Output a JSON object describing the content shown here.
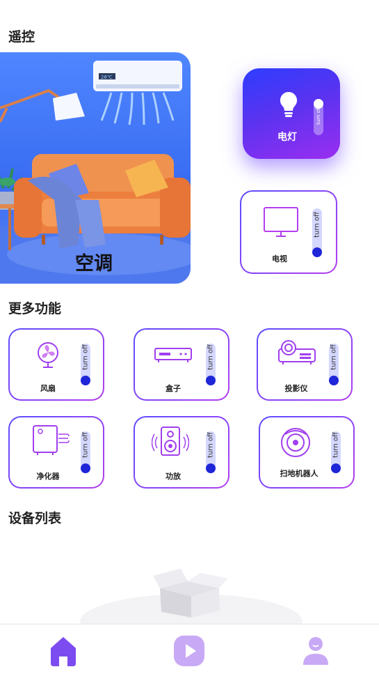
{
  "sections": {
    "remote": "遥控",
    "more": "更多功能",
    "devices": "设备列表"
  },
  "hero": {
    "label": "空调",
    "ac_display": "26℃"
  },
  "light": {
    "label": "电灯",
    "toggle": "turn off"
  },
  "tv": {
    "label": "电视",
    "toggle": "turn off"
  },
  "functions": [
    {
      "label": "风扇",
      "icon": "fan-icon",
      "toggle": "turn off"
    },
    {
      "label": "盒子",
      "icon": "set-top-box-icon",
      "toggle": "turn off"
    },
    {
      "label": "投影仪",
      "icon": "projector-icon",
      "toggle": "turn off"
    },
    {
      "label": "净化器",
      "icon": "air-purifier-icon",
      "toggle": "turn off"
    },
    {
      "label": "功放",
      "icon": "speaker-icon",
      "toggle": "turn off"
    },
    {
      "label": "扫地机器人",
      "icon": "robot-vacuum-icon",
      "toggle": "turn off"
    }
  ],
  "nav": [
    {
      "icon": "home-icon"
    },
    {
      "icon": "play-icon"
    },
    {
      "icon": "profile-icon"
    }
  ],
  "colors": {
    "accent": "#6b4cf5",
    "accent_dark": "#1f26d8",
    "light_card_start": "#2e3dff",
    "light_card_end": "#9a2ef0"
  }
}
